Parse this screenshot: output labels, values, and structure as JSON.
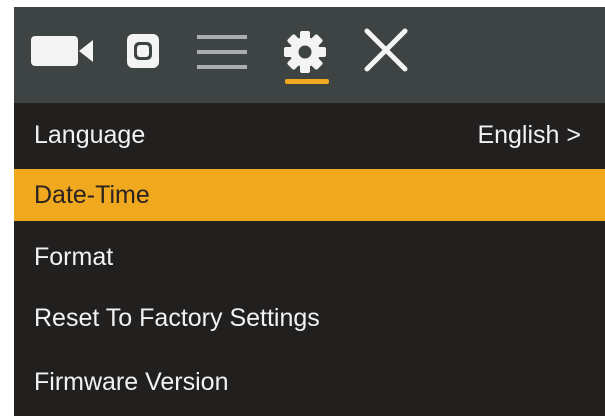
{
  "toolbar": {
    "icons": [
      "video-camera-icon",
      "photo-camera-icon",
      "menu-icon",
      "gear-icon",
      "close-icon"
    ],
    "active": "settings",
    "accent_color": "#f0a81f"
  },
  "menu": {
    "selected_index": 1,
    "items": [
      {
        "label": "Language",
        "value": "English >"
      },
      {
        "label": "Date-Time"
      },
      {
        "label": "Format"
      },
      {
        "label": "Reset To Factory Settings"
      },
      {
        "label": "Firmware Version"
      }
    ]
  },
  "colors": {
    "toolbar_bg": "#3e4343",
    "menu_bg": "#221f1f",
    "highlight": "#f0a81f",
    "text": "#f2f2f2"
  }
}
